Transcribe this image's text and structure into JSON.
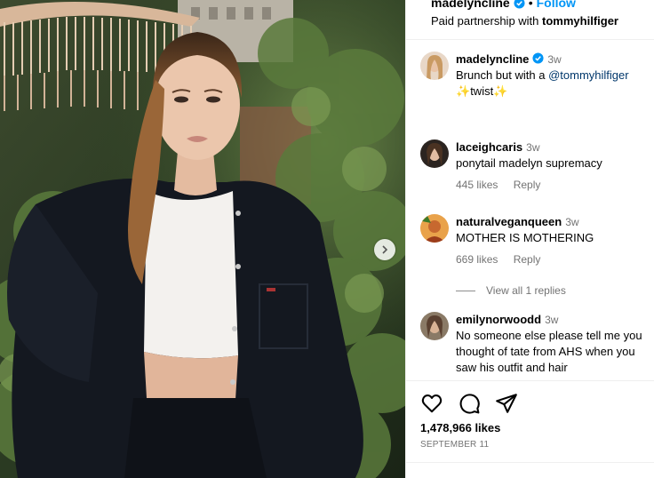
{
  "header": {
    "username": "madelyncline",
    "separator": "•",
    "follow_label": "Follow",
    "partnership_prefix": "Paid partnership with",
    "partner": "tommyhilfiger"
  },
  "caption": {
    "username": "madelyncline",
    "time": "3w",
    "text_before": "Brunch but with a",
    "mention": "@tommyhilfiger",
    "sparkle_left": "✨",
    "text_mid": "twist",
    "sparkle_right": "✨"
  },
  "comments": [
    {
      "username": "laceighcaris",
      "time": "3w",
      "text": "ponytail madelyn supremacy",
      "likes": "445 likes",
      "reply": "Reply"
    },
    {
      "username": "naturalveganqueen",
      "time": "3w",
      "text": "MOTHER IS MOTHERING",
      "likes": "669 likes",
      "reply": "Reply"
    },
    {
      "username": "emilynorwoodd",
      "time": "3w",
      "text": "No someone else please tell me you thought of tate from AHS when you saw his outfit and hair"
    }
  ],
  "view_replies": "View all 1 replies",
  "actions": {
    "like_icon": "heart-icon",
    "comment_icon": "comment-icon",
    "share_icon": "send-icon"
  },
  "likes_count": "1,478,966 likes",
  "post_date": "SEPTEMBER 11",
  "colors": {
    "link": "#0095f6",
    "muted": "#737373",
    "mention": "#00376b",
    "verified": "#0095f6"
  }
}
